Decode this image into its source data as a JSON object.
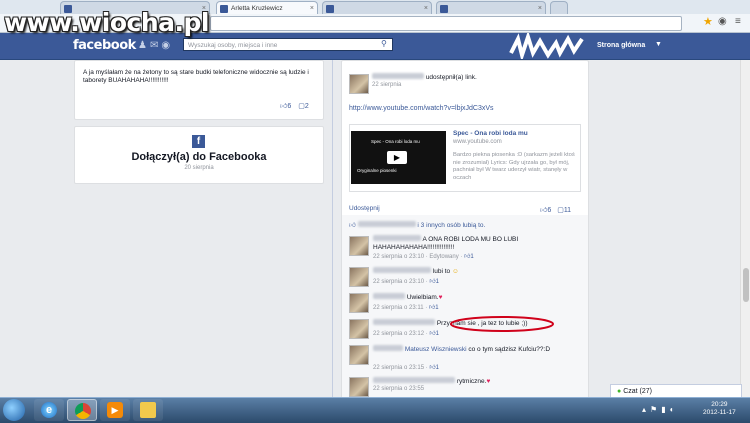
{
  "watermark": "www.wiocha.pl",
  "browser": {
    "tabs": [
      {
        "label": ""
      },
      {
        "label": "Arletta Kruzlewicz"
      },
      {
        "label": ""
      },
      {
        "label": ""
      }
    ]
  },
  "fb": {
    "logo": "facebook",
    "search_placeholder": "Wyszukaj osoby, miejsca i inne",
    "home": "Strona główna"
  },
  "left": {
    "post_text": "A ja myślałam że na żetony to są stare budki telefoniczne widocznie są ludzie i taborety BUAHAHAHA!!!!!!!!!!!",
    "likes": "6",
    "comments": "2",
    "joined_title": "Dołączył(a) do Facebooka",
    "joined_date": "20 sierpnia"
  },
  "post": {
    "action": "udostępnił(a) link.",
    "date": "22 sierpnia",
    "url_text": "http://www.youtube.com/watch?v=lbjxJdC3xVs",
    "video_title": "Spec - Ona robi loda mu",
    "video_domain": "www.youtube.com",
    "video_desc": "Bardzo piekna piosenka :D (sarkazm jeżeli ktoś nie zrozumiał) Lyrics: Gdy ujrzała go, był mój, pachniał był W twarz uderzył wiatr, stanęły w oczach",
    "thumb_line1": "Spec - Ona robi loda mu",
    "thumb_line2": "Oryginalne piosenki",
    "share": "Udostępnij",
    "likes": "6",
    "comments": "11",
    "likes_summary": "i 3 innych osób lubią to."
  },
  "comments": [
    {
      "text": "A ONA ROBI LODA MU BO LUBI HAHAHAHAHAHA!!!!!!!!!!!!!!!",
      "meta": "22 sierpnia o 23:10 · Edytowany · ",
      "likes": "1"
    },
    {
      "text": "lubi to",
      "meta": "22 sierpnia o 23:10 · ",
      "likes": "1"
    },
    {
      "text": "Uwielbiam.",
      "meta": "22 sierpnia o 23:11 · ",
      "likes": "1"
    },
    {
      "text": "Przyznam sie , ja tez to lubie ;))",
      "meta": "22 sierpnia o 23:12 · ",
      "likes": "1"
    },
    {
      "author": "Mateusz Wiszniewski",
      "text": "co o tym sądzisz Kufciu??:D",
      "meta": "22 sierpnia o 23:15 · ",
      "likes": "1"
    },
    {
      "text": "rytmiczne.",
      "meta": "22 sierpnia o 23:55",
      "likes": ""
    }
  ],
  "chat": {
    "label": "Czat (27)"
  },
  "taskbar": {
    "time": "20:29",
    "date": "2012-11-17"
  },
  "colors": {
    "fb_blue": "#3b5998",
    "highlight_ellipse": "#d0021b"
  }
}
